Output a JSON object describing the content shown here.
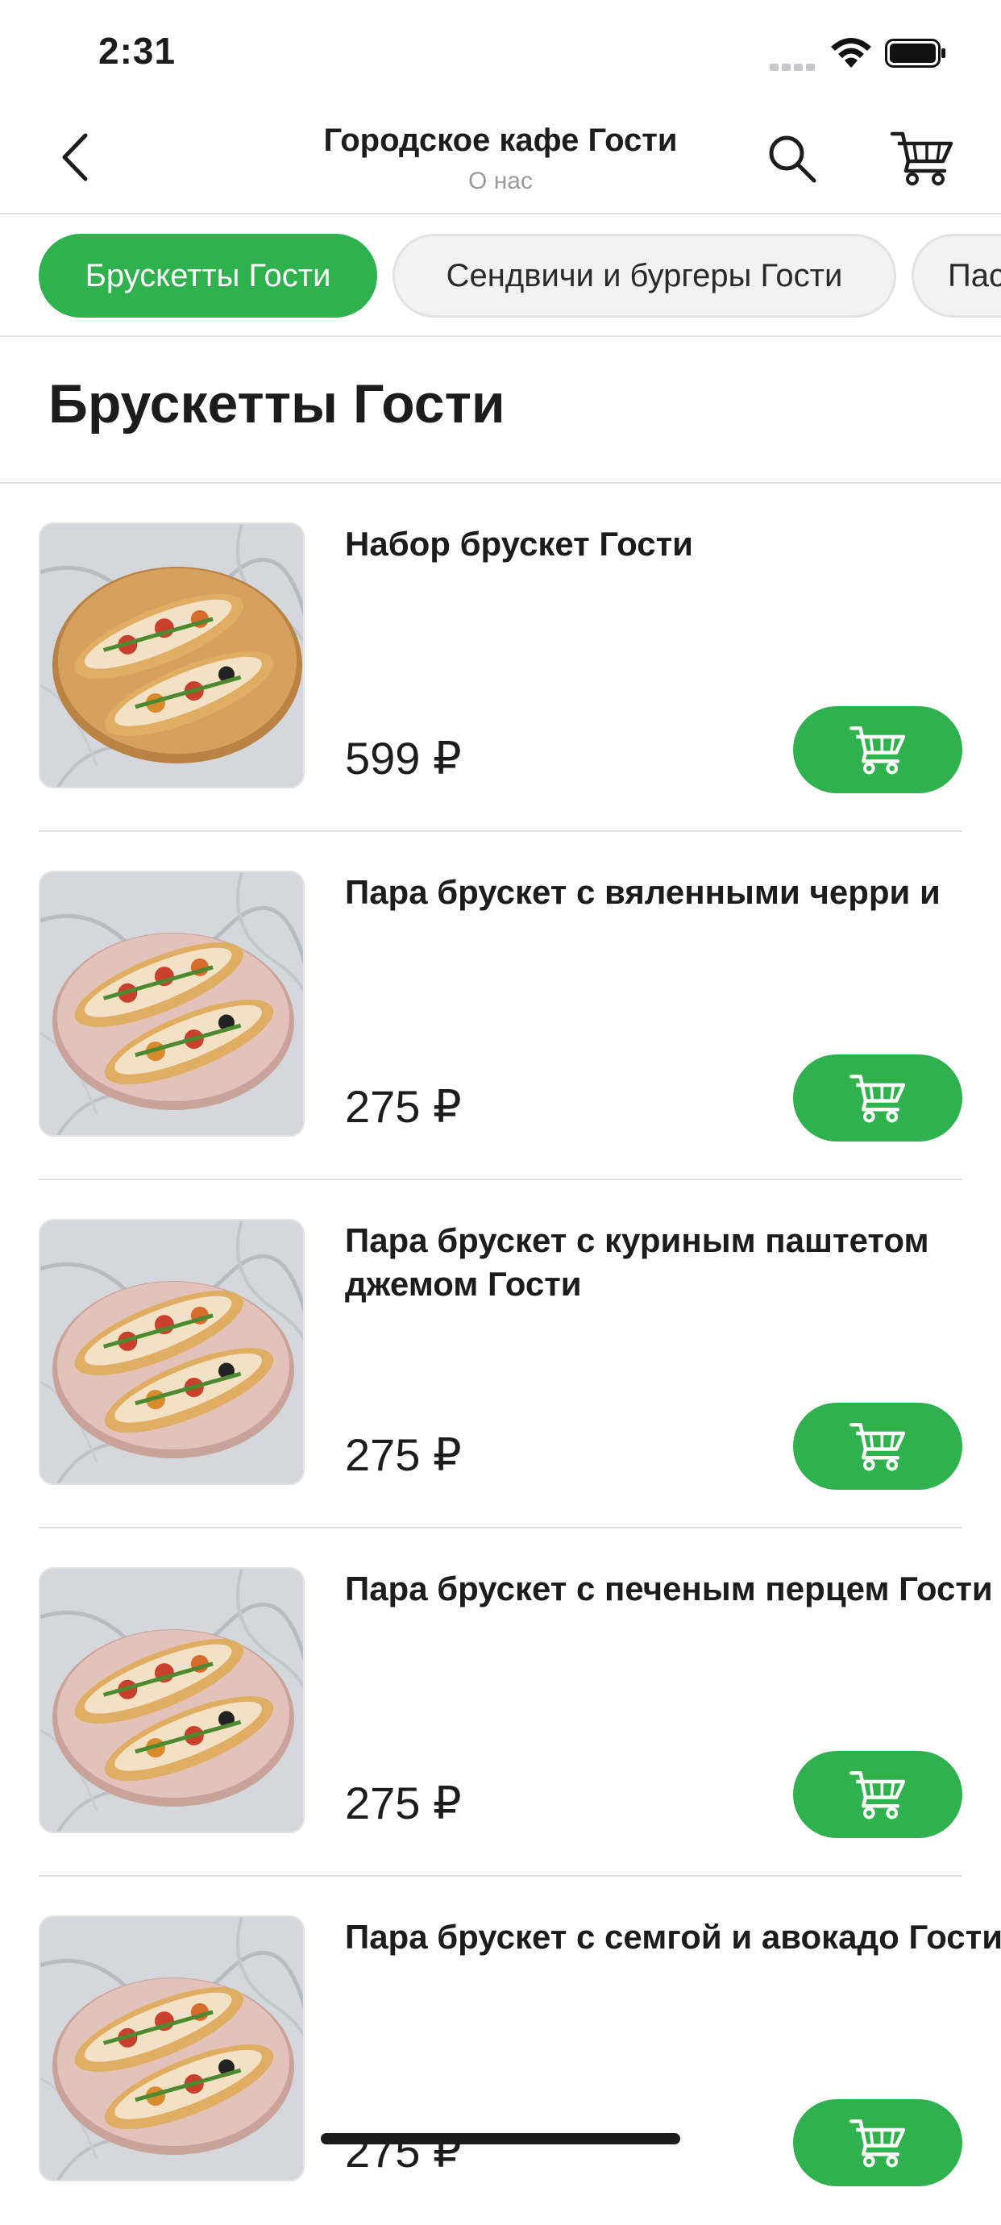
{
  "status_bar": {
    "time": "2:31"
  },
  "nav": {
    "title": "Городское кафе Гости",
    "subtitle": "О нас"
  },
  "tabs": [
    {
      "label": "Брускетты Гости",
      "active": true
    },
    {
      "label": "Сендвичи и бургеры Гости",
      "active": false
    },
    {
      "label": "Паста Гости",
      "active": false
    }
  ],
  "section": {
    "title": "Брускетты Гости"
  },
  "products": [
    {
      "name_lines": [
        "Набор брускет Гости"
      ],
      "price": "599 ₽",
      "plate": "wood"
    },
    {
      "name_lines": [
        "Пара брускет с вяленными черри и"
      ],
      "price": "275 ₽",
      "plate": "pink"
    },
    {
      "name_lines": [
        "Пара брускет с куриным паштетом",
        "джемом Гости"
      ],
      "price": "275 ₽",
      "plate": "pink"
    },
    {
      "name_lines": [
        "Пара брускет с печеным перцем Гости"
      ],
      "price": "275 ₽",
      "plate": "pink"
    },
    {
      "name_lines": [
        "Пара брускет с семгой и авокадо Гости"
      ],
      "price": "275 ₽",
      "plate": "pink"
    }
  ],
  "colors": {
    "accent": "#2fb14e",
    "divider": "#e0e0e0",
    "subtitle": "#9a9a9a"
  },
  "icons": {
    "back": "chevron-left-icon",
    "search": "search-icon",
    "cart": "cart-icon",
    "add": "cart-icon"
  }
}
